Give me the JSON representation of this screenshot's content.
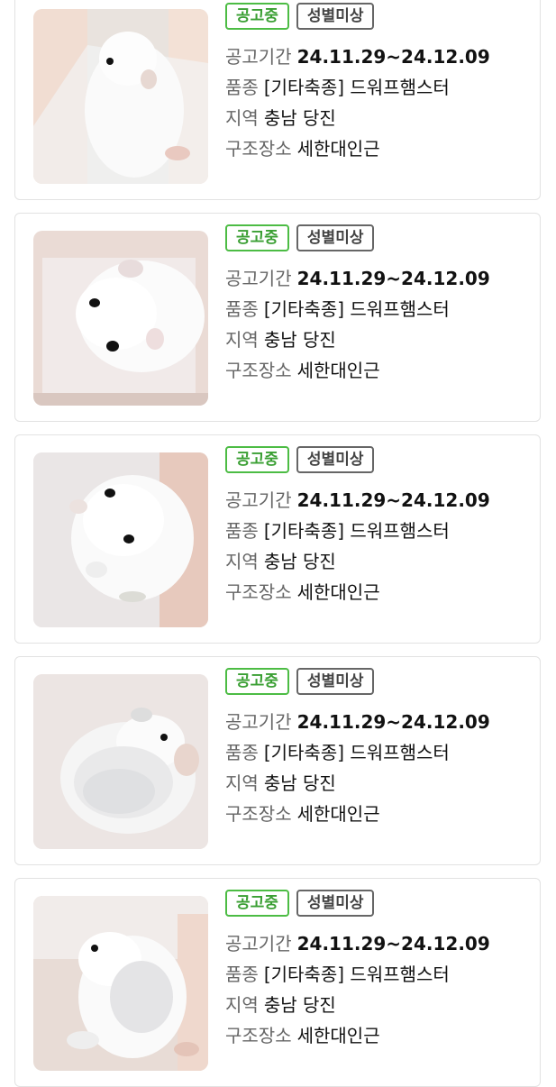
{
  "cards": [
    {
      "status": "공고중",
      "sex": "성별미상",
      "period_label": "공고기간",
      "period": "24.11.29~24.12.09",
      "breed_label": "품종",
      "breed": "[기타축종] 드워프햄스터",
      "region_label": "지역",
      "region": "충남 당진",
      "place_label": "구조장소",
      "place": "세한대인근"
    },
    {
      "status": "공고중",
      "sex": "성별미상",
      "period_label": "공고기간",
      "period": "24.11.29~24.12.09",
      "breed_label": "품종",
      "breed": "[기타축종] 드워프햄스터",
      "region_label": "지역",
      "region": "충남 당진",
      "place_label": "구조장소",
      "place": "세한대인근"
    },
    {
      "status": "공고중",
      "sex": "성별미상",
      "period_label": "공고기간",
      "period": "24.11.29~24.12.09",
      "breed_label": "품종",
      "breed": "[기타축종] 드워프햄스터",
      "region_label": "지역",
      "region": "충남 당진",
      "place_label": "구조장소",
      "place": "세한대인근"
    },
    {
      "status": "공고중",
      "sex": "성별미상",
      "period_label": "공고기간",
      "period": "24.11.29~24.12.09",
      "breed_label": "품종",
      "breed": "[기타축종] 드워프햄스터",
      "region_label": "지역",
      "region": "충남 당진",
      "place_label": "구조장소",
      "place": "세한대인근"
    },
    {
      "status": "공고중",
      "sex": "성별미상",
      "period_label": "공고기간",
      "period": "24.11.29~24.12.09",
      "breed_label": "품종",
      "breed": "[기타축종] 드워프햄스터",
      "region_label": "지역",
      "region": "충남 당진",
      "place_label": "구조장소",
      "place": "세한대인근"
    }
  ],
  "colors": {
    "status_green": "#4cbc44",
    "sex_gray": "#666666",
    "card_border": "#e2e2e2"
  }
}
